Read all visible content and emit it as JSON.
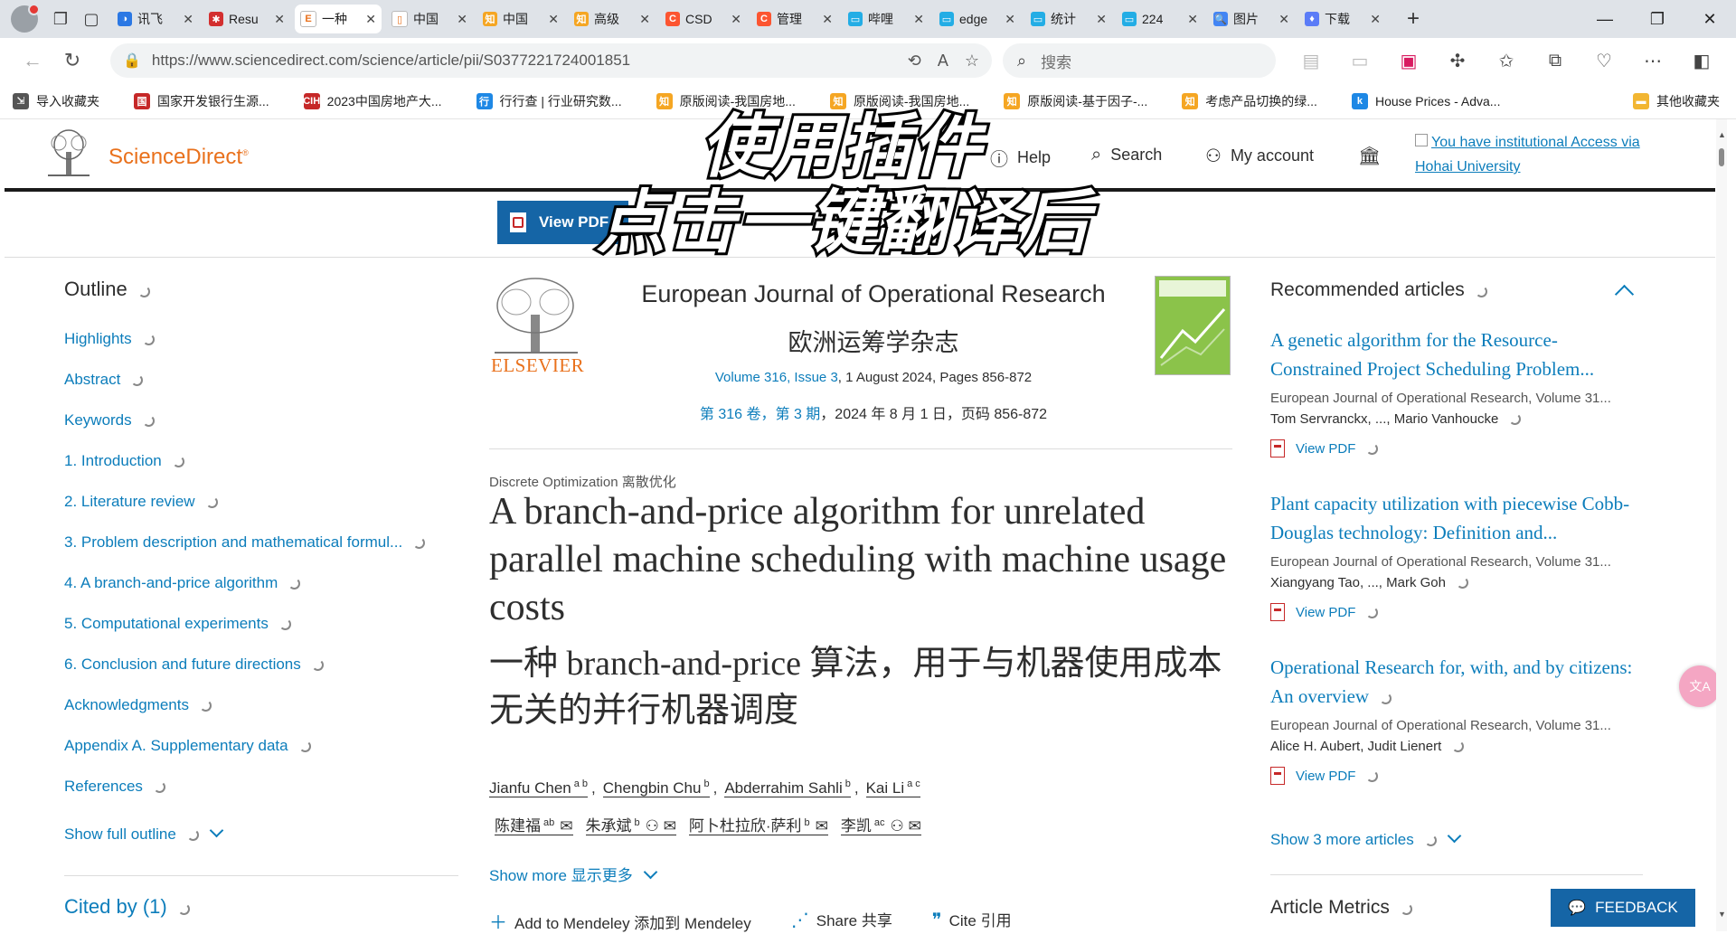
{
  "browser": {
    "tabs": [
      {
        "title": "讯飞",
        "color": "#2b78e4",
        "glyph": "◑"
      },
      {
        "title": "Resu",
        "color": "#d32f2f",
        "glyph": "✱"
      },
      {
        "title": "一种",
        "color": "#ffffff",
        "glyph": "E",
        "active": true
      },
      {
        "title": "中国",
        "color": "#ffffff",
        "glyph": "▯"
      },
      {
        "title": "中国",
        "color": "#f5a623",
        "glyph": "知"
      },
      {
        "title": "高级",
        "color": "#f5a623",
        "glyph": "知"
      },
      {
        "title": "CSD",
        "color": "#fc5531",
        "glyph": "C"
      },
      {
        "title": "管理",
        "color": "#fc5531",
        "glyph": "C"
      },
      {
        "title": "哔哩",
        "color": "#23ade5",
        "glyph": "▭"
      },
      {
        "title": "edge",
        "color": "#23ade5",
        "glyph": "▭"
      },
      {
        "title": "统计",
        "color": "#23ade5",
        "glyph": "▭"
      },
      {
        "title": "224",
        "color": "#23ade5",
        "glyph": "▭"
      },
      {
        "title": "图片",
        "color": "#4285f4",
        "glyph": "🔍"
      },
      {
        "title": "下载",
        "color": "#5b7cf7",
        "glyph": "♦"
      }
    ],
    "url": "https://www.sciencedirect.com/science/article/pii/S0377221724001851",
    "search_placeholder": "搜索",
    "bookmarks": [
      {
        "label": "导入收藏夹",
        "color": "#555555",
        "glyph": "⇲"
      },
      {
        "label": "国家开发银行生源...",
        "color": "#c62828",
        "glyph": "国"
      },
      {
        "label": "2023中国房地产大...",
        "color": "#c62828",
        "glyph": "CIH"
      },
      {
        "label": "行行查 | 行业研究数...",
        "color": "#1e88e5",
        "glyph": "行"
      },
      {
        "label": "原版阅读-我国房地...",
        "color": "#f5a623",
        "glyph": "知"
      },
      {
        "label": "原版阅读-我国房地...",
        "color": "#f5a623",
        "glyph": "知"
      },
      {
        "label": "原版阅读-基于因子-...",
        "color": "#f5a623",
        "glyph": "知"
      },
      {
        "label": "考虑产品切换的绿...",
        "color": "#f5a623",
        "glyph": "知"
      },
      {
        "label": "House Prices - Adva...",
        "color": "#1e88e5",
        "glyph": "k"
      }
    ],
    "other_bookmarks": "其他收藏夹"
  },
  "header": {
    "brand": "ScienceDirect",
    "help": "Help",
    "search": "Search",
    "account": "My account",
    "institution_line1": "You have institutional Access via",
    "institution_line2": "Hohai University"
  },
  "overlay": {
    "line1": "使用插件",
    "line2": "点击一键翻译后"
  },
  "toolbar": {
    "view_pdf": "View PDF"
  },
  "outline": {
    "title": "Outline",
    "items": [
      "Highlights",
      "Abstract",
      "Keywords",
      "1. Introduction",
      "2. Literature review",
      "3. Problem description and mathematical formul...",
      "4. A branch-and-price algorithm",
      "5. Computational experiments",
      "6. Conclusion and future directions",
      "Acknowledgments",
      "Appendix A. Supplementary data",
      "References"
    ],
    "show_full": "Show full outline",
    "cited_by": "Cited by (1)"
  },
  "article": {
    "publisher": "ELSEVIER",
    "journal": "European Journal of Operational Research",
    "journal_zh": "欧洲运筹学杂志",
    "volume_link": "Volume 316, Issue 3",
    "volume_rest": ", 1 August 2024, Pages 856-872",
    "volume_zh_link": "第 316 卷，第 3 期",
    "volume_zh_rest": "，2024 年 8 月 1 日，页码 856-872",
    "section": "Discrete Optimization 离散优化",
    "title": "A branch-and-price algorithm for unrelated parallel machine scheduling with machine usage costs",
    "title_zh": "一种 branch-and-price 算法，用于与机器使用成本无关的并行机器调度",
    "authors": [
      {
        "name": "Jianfu Chen",
        "sup": "a b"
      },
      {
        "name": "Chengbin Chu",
        "sup": "b"
      },
      {
        "name": "Abderrahim Sahli",
        "sup": "b"
      },
      {
        "name": "Kai Li",
        "sup": "a c"
      }
    ],
    "authors_zh": [
      {
        "name": "陈建福",
        "sup": "ab",
        "icons": "✉"
      },
      {
        "name": "朱承斌",
        "sup": "b",
        "icons": "⚇ ✉"
      },
      {
        "name": "阿卜杜拉欣·萨利",
        "sup": "b",
        "icons": "✉"
      },
      {
        "name": "李凯",
        "sup": "ac",
        "icons": "⚇ ✉"
      }
    ],
    "show_more": "Show more 显示更多",
    "mendeley": "Add to Mendeley 添加到 Mendeley",
    "share": "Share 共享",
    "cite": "Cite 引用"
  },
  "recommended": {
    "title": "Recommended articles",
    "articles": [
      {
        "title": "A genetic algorithm for the Resource-Constrained Project Scheduling Problem...",
        "source": "European Journal of Operational Research, Volume 31...",
        "authors": "Tom Servranckx, ..., Mario Vanhoucke",
        "view_pdf": "View PDF"
      },
      {
        "title": "Plant capacity utilization with piecewise Cobb-Douglas technology: Definition and...",
        "source": "European Journal of Operational Research, Volume 31...",
        "authors": "Xiangyang Tao, ..., Mark Goh",
        "view_pdf": "View PDF"
      },
      {
        "title": "Operational Research for, with, and by citizens: An overview",
        "source": "European Journal of Operational Research, Volume 31...",
        "authors": "Alice H. Aubert, Judit Lienert",
        "view_pdf": "View PDF"
      }
    ],
    "show_more": "Show 3 more articles",
    "metrics": "Article Metrics"
  },
  "feedback": "FEEDBACK"
}
